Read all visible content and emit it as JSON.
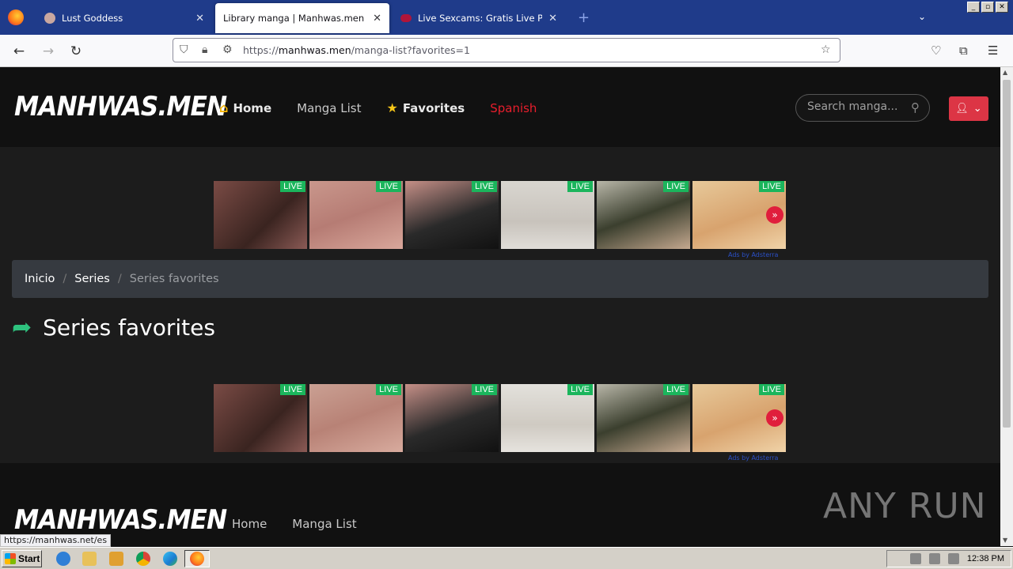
{
  "browser": {
    "tabs": [
      {
        "label": "Lust Goddess",
        "active": false
      },
      {
        "label": "Library manga | Manhwas.men",
        "active": true
      },
      {
        "label": "Live Sexcams: Gratis Live Porn Cha",
        "active": false
      }
    ],
    "url_prefix": "https://",
    "url_domain": "manhwas.men",
    "url_path": "/manga-list?favorites=1",
    "window_buttons": [
      "_",
      "▫",
      "✕"
    ]
  },
  "site": {
    "logo": "MANHWAS.MEN",
    "menu": {
      "home": "Home",
      "manga_list": "Manga List",
      "favorites": "Favorites",
      "spanish": "Spanish"
    },
    "search_placeholder": "Search manga...",
    "live_badge": "LIVE",
    "ads_by": "Ads by Adsterra",
    "breadcrumb": {
      "inicio": "Inicio",
      "series": "Series",
      "current": "Series favorites"
    },
    "page_title": "Series favorites",
    "footer": {
      "logo": "MANHWAS.MEN",
      "home": "Home",
      "manga_list": "Manga List"
    },
    "status_url": "https://manhwas.net/es",
    "watermark": "ANY RUN"
  },
  "taskbar": {
    "start": "Start",
    "clock": "12:38 PM"
  },
  "colors": {
    "accent_red": "#dc3545",
    "live_green": "#1bb55c",
    "title_arrow": "#2ec27e"
  }
}
